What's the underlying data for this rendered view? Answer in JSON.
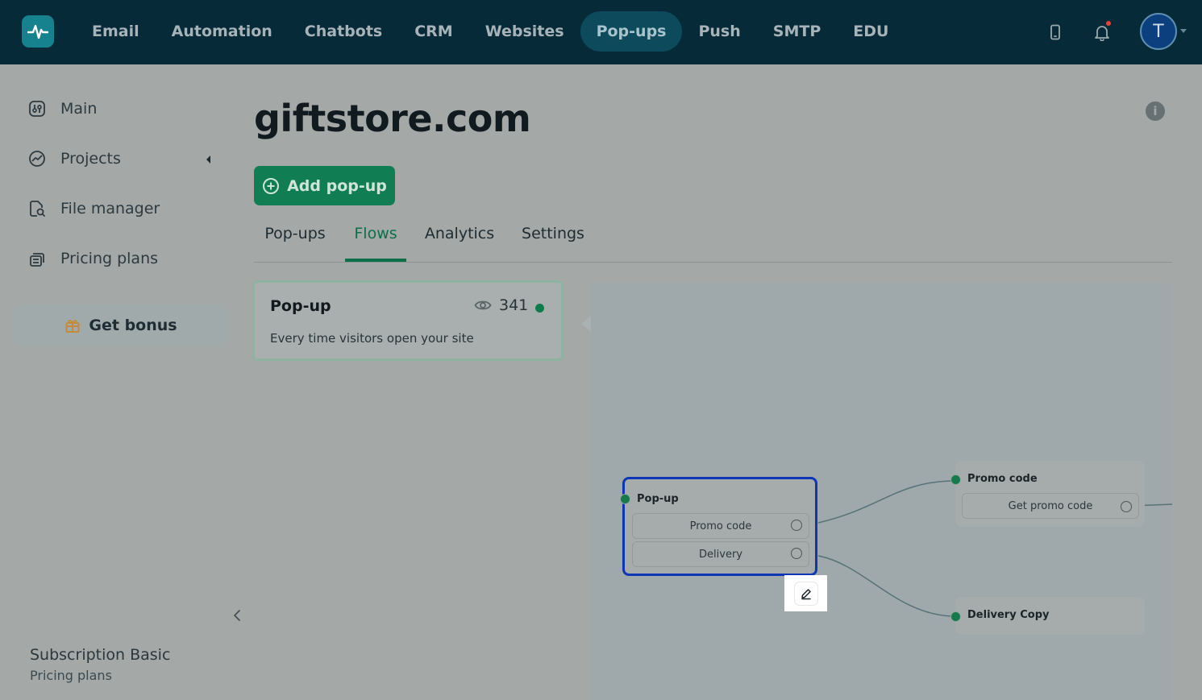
{
  "nav": {
    "items": [
      {
        "label": "Email"
      },
      {
        "label": "Automation"
      },
      {
        "label": "Chatbots"
      },
      {
        "label": "CRM"
      },
      {
        "label": "Websites"
      },
      {
        "label": "Pop-ups",
        "active": true
      },
      {
        "label": "Push"
      },
      {
        "label": "SMTP"
      },
      {
        "label": "EDU"
      }
    ],
    "icons": [
      "mobile-icon",
      "bell-icon"
    ],
    "avatar_initial": "T"
  },
  "sidebar": {
    "items": [
      {
        "label": "Main",
        "icon": "sliders-icon"
      },
      {
        "label": "Projects",
        "icon": "chart-icon"
      },
      {
        "label": "File manager",
        "icon": "file-search-icon"
      },
      {
        "label": "Pricing plans",
        "icon": "layers-icon"
      }
    ],
    "bonus_label": "Get bonus",
    "subscription_title": "Subscription Basic",
    "subscription_link": "Pricing plans"
  },
  "main": {
    "title": "giftstore.com",
    "add_button": "Add pop-up",
    "tabs": [
      {
        "label": "Pop-ups"
      },
      {
        "label": "Flows",
        "active": true
      },
      {
        "label": "Analytics"
      },
      {
        "label": "Settings"
      }
    ]
  },
  "flow_card": {
    "name": "Pop-up",
    "views": "341",
    "description": "Every time visitors open your site"
  },
  "canvas": {
    "popup_node": {
      "title": "Pop-up",
      "rows": [
        "Promo code",
        "Delivery"
      ]
    },
    "promo_node": {
      "title": "Promo code",
      "rows": [
        "Get promo code"
      ]
    },
    "delivery_node": {
      "title": "Delivery Copy"
    }
  },
  "colors": {
    "nav_bg": "#062a38",
    "accent_green": "#117d52",
    "selected_node": "#0f37b5"
  }
}
